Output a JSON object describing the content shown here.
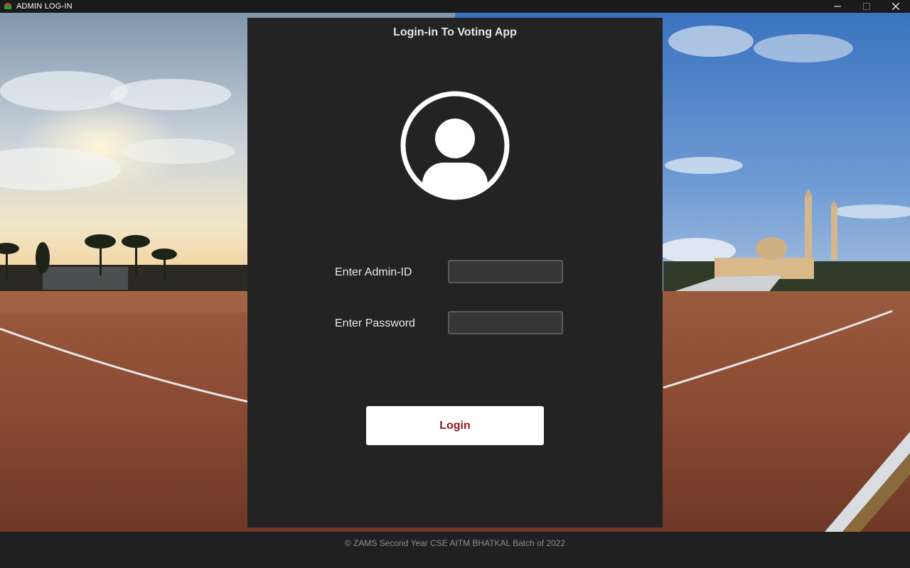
{
  "window": {
    "title": "ADMIN LOG-IN",
    "icons": {
      "app": "app-icon",
      "minimize": "minimize-icon",
      "maximize": "maximize-icon",
      "close": "close-icon"
    }
  },
  "panel": {
    "title": "Login-in To Voting App",
    "avatar_icon": "user-avatar-icon",
    "fields": {
      "admin_id": {
        "label": "Enter Admin-ID",
        "value": "",
        "placeholder": ""
      },
      "password": {
        "label": "Enter Password",
        "value": "",
        "placeholder": ""
      }
    },
    "login_label": "Login"
  },
  "footer": {
    "text": "© ZAMS Second Year CSE AITM BHATKAL Batch of 2022"
  },
  "colors": {
    "panel_bg": "#232323",
    "login_text": "#8b1a1a",
    "input_bg": "#363636"
  }
}
